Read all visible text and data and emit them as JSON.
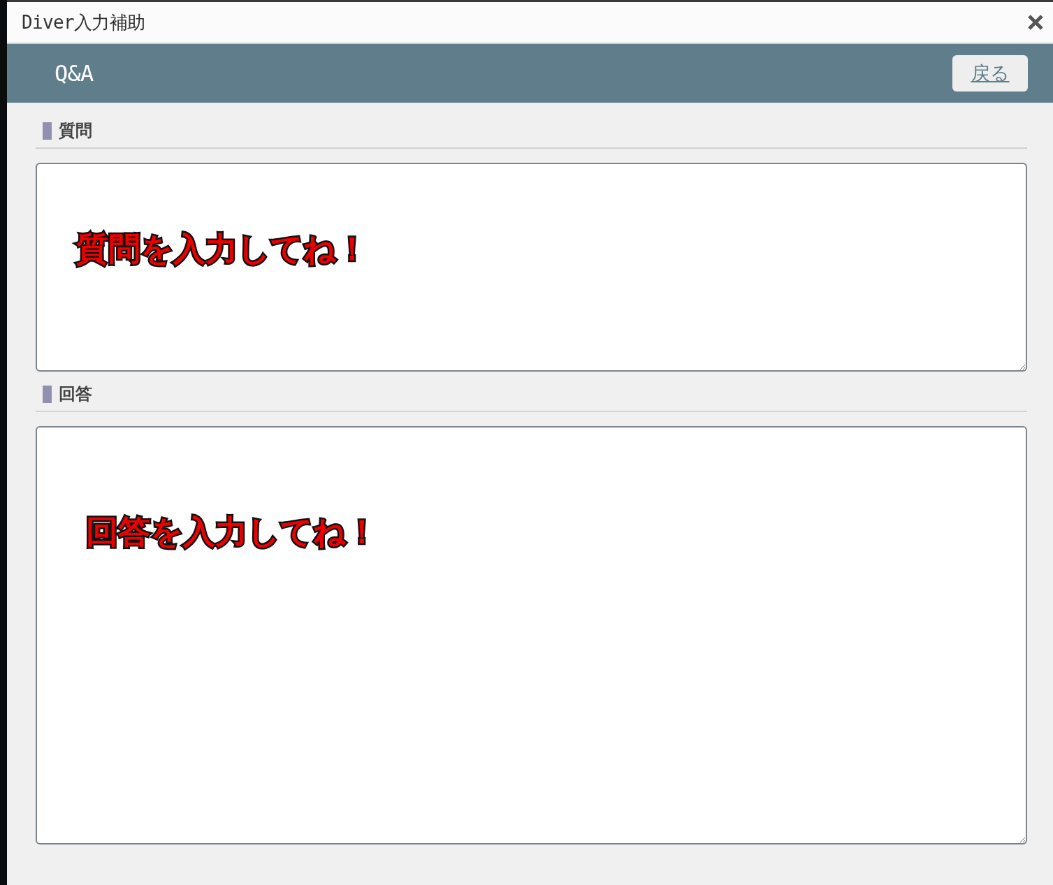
{
  "window": {
    "title": "Diver入力補助"
  },
  "header": {
    "title": "Q&A",
    "back_button": "戻る"
  },
  "sections": [
    {
      "heading": "質問",
      "annotation": "質問を入力してね！"
    },
    {
      "heading": "回答",
      "annotation": "回答を入力してね！"
    }
  ]
}
